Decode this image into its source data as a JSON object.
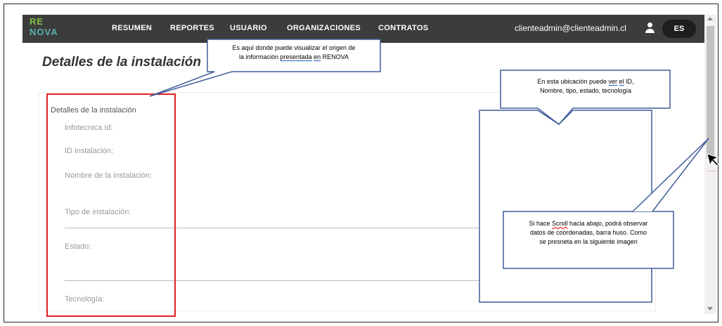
{
  "nav": {
    "logo_line1": "RE",
    "logo_line2": "NOVA",
    "items": [
      "RESUMEN",
      "REPORTES",
      "USUARIO",
      "ORGANIZACIONES",
      "CONTRATOS"
    ],
    "email": "clienteadmin@clienteadmin.cl",
    "lang": "ES"
  },
  "page": {
    "title": "Detalles de la instalación"
  },
  "card": {
    "title": "Detalles de la instalación",
    "fields": [
      "Infotecnica Id:",
      "ID instalación:",
      "Nombre de la instalación:",
      "Tipo de instalación:",
      "Estado:",
      "Tecnología:"
    ]
  },
  "callouts": {
    "top": {
      "line1": "Es aquí donde puede visualizar el origen de",
      "line2_a": "la información ",
      "line2_b": "presentada",
      "line2_c": " ",
      "line2_d": "en",
      "line2_e": " RENOVA"
    },
    "right": {
      "line1_a": "En esta ubicación puede ",
      "line1_b": "ver",
      "line1_c": " ",
      "line1_d": "el",
      "line1_e": " ID,",
      "line2": "Nombre, tipo, estado, tecnología"
    },
    "scroll": {
      "line1_a": "Si hace ",
      "line1_b": "Scroll",
      "line1_c": " hacia abajo, podrá observar",
      "line2": "datos de coordenadas, barra huso.  Como",
      "line3": "se presneta en la siguiente imagen"
    }
  },
  "colors": {
    "nav_bg": "#3c3c3c",
    "highlight": "#e31e24",
    "callout_border": "#3f5c99"
  }
}
